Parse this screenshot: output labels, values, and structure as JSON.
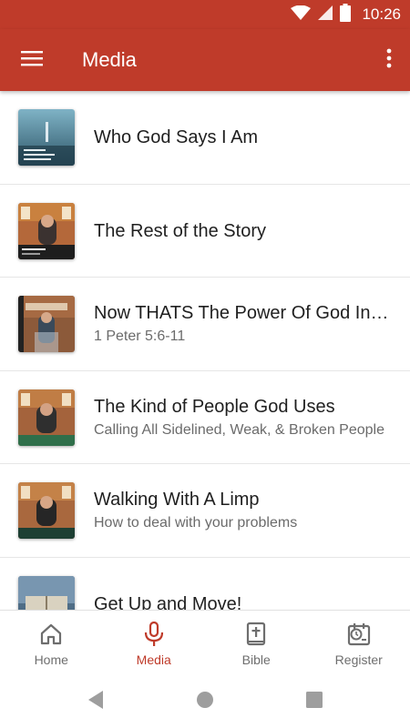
{
  "status_bar": {
    "time": "10:26",
    "icons": [
      "wifi-icon",
      "cellular-signal-icon",
      "battery-icon"
    ]
  },
  "app_bar": {
    "title": "Media",
    "menu_icon": "hamburger-menu-icon",
    "overflow_icon": "more-vertical-icon"
  },
  "colors": {
    "primary": "#bf3b2a",
    "title_text": "#1f1f1f",
    "subtitle_text": "#6b6b6b",
    "inactive_nav": "#6e6e6e"
  },
  "media_items": [
    {
      "title": "Who God Says I Am",
      "subtitle": ""
    },
    {
      "title": "The Rest of the Story",
      "subtitle": ""
    },
    {
      "title": "Now THATS The Power Of God In Your Life",
      "subtitle": "1 Peter 5:6-11"
    },
    {
      "title": "The Kind of People God Uses",
      "subtitle": "Calling All Sidelined, Weak, & Broken People"
    },
    {
      "title": "Walking With A Limp",
      "subtitle": "How to deal with your problems"
    },
    {
      "title": "Get Up and Move!",
      "subtitle": ""
    }
  ],
  "bottom_nav": {
    "tabs": [
      {
        "label": "Home",
        "icon": "home-icon",
        "active": false
      },
      {
        "label": "Media",
        "icon": "microphone-icon",
        "active": true
      },
      {
        "label": "Bible",
        "icon": "bible-icon",
        "active": false
      },
      {
        "label": "Register",
        "icon": "calendar-clock-icon",
        "active": false
      }
    ]
  },
  "system_nav": [
    "back-icon",
    "home-circle-icon",
    "recents-icon"
  ]
}
